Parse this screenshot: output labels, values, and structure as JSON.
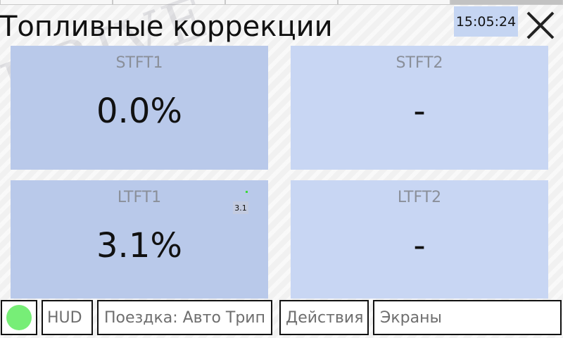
{
  "header": {
    "title": "Топливные коррекции",
    "clock": "15:05:24"
  },
  "watermark": "DRIVE",
  "tiles": [
    {
      "label": "STFT1",
      "value": "0.0%"
    },
    {
      "label": "STFT2",
      "value": "-"
    },
    {
      "label": "LTFT1",
      "value": "3.1%",
      "sparkline_value": "3.1"
    },
    {
      "label": "LTFT2",
      "value": "-"
    }
  ],
  "bottom_bar": {
    "status_color": "#77ee77",
    "hud_label": "HUD",
    "trip_label": "Поездка: Авто Трип",
    "actions_label": "Действия",
    "screens_label": "Экраны"
  },
  "colors": {
    "tile_left": "#b9c9ea",
    "tile_right": "#c8d6f3",
    "clock_bg": "#c5d5f2"
  }
}
